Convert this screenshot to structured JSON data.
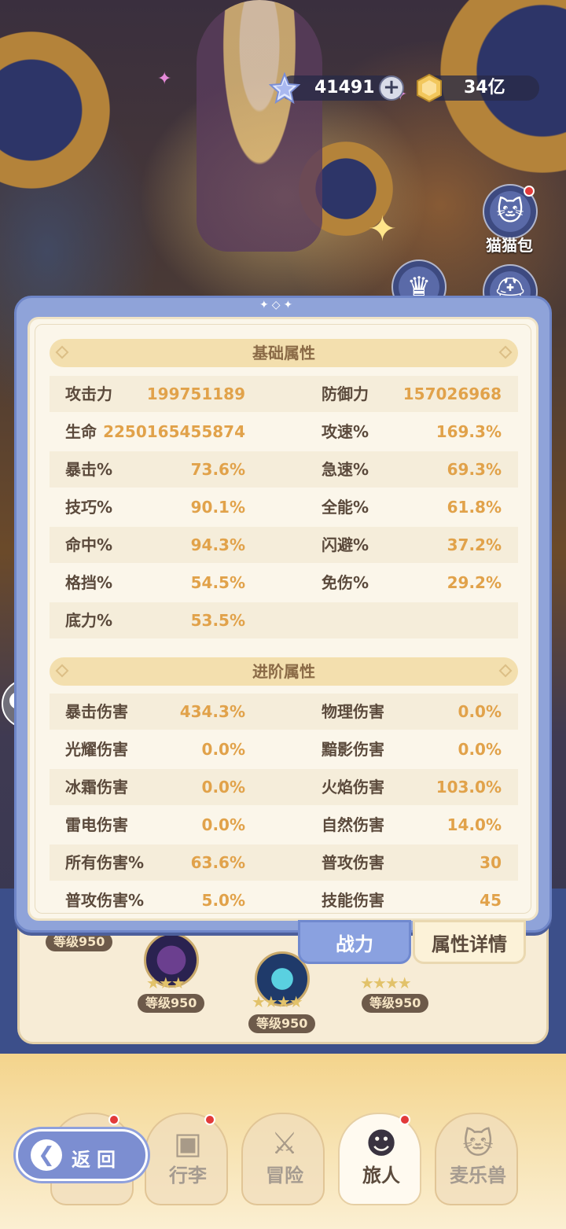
{
  "currency": {
    "stars_value": "41491",
    "gold_value": "34亿"
  },
  "side": {
    "cat_bag_label": "猫猫包"
  },
  "sections": {
    "basic_title": "基础属性",
    "advanced_title": "进阶属性"
  },
  "basic_rows": [
    {
      "l1": "攻击力",
      "v1": "199751189",
      "l2": "防御力",
      "v2": "157026968"
    },
    {
      "l1": "生命",
      "v1": "2250165455874",
      "l2": "攻速%",
      "v2": "169.3%"
    },
    {
      "l1": "暴击%",
      "v1": "73.6%",
      "l2": "急速%",
      "v2": "69.3%"
    },
    {
      "l1": "技巧%",
      "v1": "90.1%",
      "l2": "全能%",
      "v2": "61.8%"
    },
    {
      "l1": "命中%",
      "v1": "94.3%",
      "l2": "闪避%",
      "v2": "37.2%"
    },
    {
      "l1": "格挡%",
      "v1": "54.5%",
      "l2": "免伤%",
      "v2": "29.2%"
    },
    {
      "l1": "底力%",
      "v1": "53.5%",
      "l2": "",
      "v2": ""
    }
  ],
  "advanced_rows": [
    {
      "l1": "暴击伤害",
      "v1": "434.3%",
      "l2": "物理伤害",
      "v2": "0.0%"
    },
    {
      "l1": "光耀伤害",
      "v1": "0.0%",
      "l2": "黯影伤害",
      "v2": "0.0%"
    },
    {
      "l1": "冰霜伤害",
      "v1": "0.0%",
      "l2": "火焰伤害",
      "v2": "103.0%"
    },
    {
      "l1": "雷电伤害",
      "v1": "0.0%",
      "l2": "自然伤害",
      "v2": "14.0%"
    },
    {
      "l1": "所有伤害%",
      "v1": "63.6%",
      "l2": "普攻伤害",
      "v2": "30"
    },
    {
      "l1": "普攻伤害%",
      "v1": "5.0%",
      "l2": "技能伤害",
      "v2": "45"
    }
  ],
  "tabs": {
    "power": "战力",
    "detail": "属性详情"
  },
  "levels": {
    "a": "等级950",
    "b": "等级950",
    "c": "等级950",
    "d": "等级950"
  },
  "nav": {
    "back": "返回",
    "items": [
      "行李",
      "冒险",
      "旅人",
      "麦乐兽"
    ]
  },
  "icons": {
    "star_currency": "crystal-star-icon",
    "gold_currency": "gold-coin-icon",
    "plus": "plus-icon",
    "cat_bag": "cat-bag-icon",
    "chat": "chat-bubble-icon",
    "back_arrow": "back-arrow-icon"
  },
  "colors": {
    "panel_blue": "#8fa3d9",
    "value_orange": "#e1a24a",
    "label_brown": "#5b4a3c"
  }
}
